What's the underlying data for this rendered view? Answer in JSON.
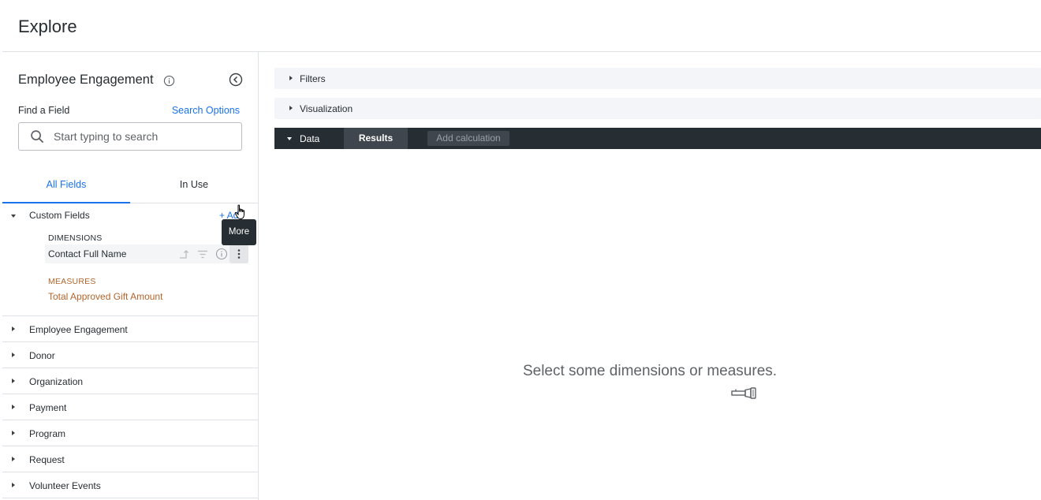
{
  "header": {
    "title": "Explore"
  },
  "sidebar": {
    "model_title": "Employee Engagement",
    "find_label": "Find a Field",
    "search_options": "Search Options",
    "search_placeholder": "Start typing to search",
    "tabs": [
      {
        "label": "All Fields",
        "active": true
      },
      {
        "label": "In Use",
        "active": false
      }
    ],
    "custom_fields": {
      "label": "Custom Fields",
      "add_label": "+ Add",
      "dimensions_label": "DIMENSIONS",
      "dimension_field": "Contact Full Name",
      "measures_label": "MEASURES",
      "measure_field": "Total Approved Gift Amount"
    },
    "tooltip": "More",
    "views": [
      {
        "label": "Employee Engagement"
      },
      {
        "label": "Donor"
      },
      {
        "label": "Organization"
      },
      {
        "label": "Payment"
      },
      {
        "label": "Program"
      },
      {
        "label": "Request"
      },
      {
        "label": "Volunteer Events"
      }
    ]
  },
  "main": {
    "filters_label": "Filters",
    "visualization_label": "Visualization",
    "data_label": "Data",
    "results_label": "Results",
    "add_calculation_label": "Add calculation",
    "empty_message": "Select some dimensions or measures."
  },
  "colors": {
    "accent": "#1a73e8",
    "measure": "#b3652b",
    "dark_bar": "#262d33"
  },
  "icons": [
    "info-icon",
    "collapse-panel-icon",
    "search-icon",
    "pivot-icon",
    "filter-icon",
    "more-vert-icon",
    "flashlight-icon"
  ]
}
